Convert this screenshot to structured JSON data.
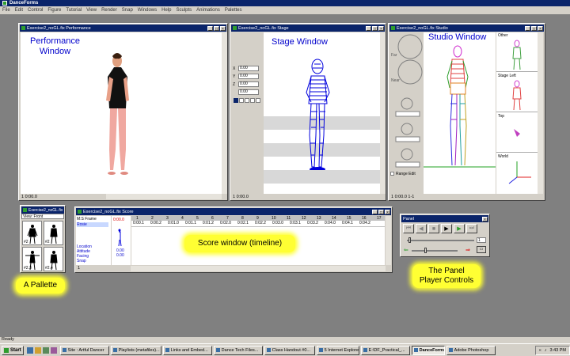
{
  "app": {
    "title": "DanceForms"
  },
  "menu": [
    "File",
    "Edit",
    "Control",
    "Figure",
    "Tutorial",
    "View",
    "Render",
    "Snap",
    "Windows",
    "Help",
    "Sculpts",
    "Animations",
    "Palettes"
  ],
  "windows": {
    "performance": {
      "title": "Exercise2_noGL.fix Performance",
      "caption": "Performance\nWindow",
      "status": "1 0:00.0"
    },
    "stage": {
      "title": "Exercise2_noGL.fix Stage",
      "caption": "Stage Window",
      "status": "1 0:00.0",
      "fields": [
        "0.00",
        "0.00",
        "0.00",
        "0.00"
      ],
      "field_labels": [
        "X",
        "Y",
        "Z",
        ""
      ]
    },
    "studio": {
      "title": "Exercise2_noGL.fix Studio",
      "caption": "Studio Window",
      "status": "1 0:00.0 1-1",
      "dial_labels": [
        "Far",
        "Near"
      ],
      "range_edit": "Range Edit",
      "views": [
        "Other",
        "Stage Left",
        "Top",
        "World"
      ]
    },
    "palette": {
      "title": "Exercise2_noGL.fix",
      "view": "View: Front",
      "cells": [
        "#2",
        "#2",
        "#2.3",
        "#2.4"
      ]
    },
    "score": {
      "title": "Exercise2_noGL.fix Score",
      "rows": [
        "M:S Frame",
        "Rosie",
        "",
        "Location",
        "Attitude",
        "Facing",
        "Snap"
      ],
      "frame_value": "0:00.0",
      "values": [
        "0.00",
        "0.00"
      ],
      "ticks": [
        "1",
        "2",
        "3",
        "4",
        "5",
        "6",
        "7",
        "8",
        "9",
        "10",
        "11",
        "12",
        "13",
        "14",
        "15",
        "16",
        "17"
      ],
      "times": [
        "0:00.1",
        "0:00.2",
        "0:01.0",
        "0:01.1",
        "0:01.2",
        "0:02.0",
        "0:02.1",
        "0:02.2",
        "0:03.0",
        "0:03.1",
        "0:03.2",
        "0:04.0",
        "0:04.1",
        "0:04.2"
      ],
      "status": "1"
    },
    "panel": {
      "title": "Panel",
      "frame": "1"
    }
  },
  "annotations": {
    "score": "Score window (timeline)",
    "palette": "A Pallette",
    "panel": "The Panel\nPlayer Controls"
  },
  "status_bar": "Ready",
  "taskbar": {
    "start": "Start",
    "tasks": [
      "Site : Artful Dancer",
      "Playlists (metafiles)...",
      "Links and Embed...",
      "Dance Tech Files...",
      "Class Handout #0...",
      "5 Internet Explorer",
      "E:\\DF_Practical_...",
      "DanceForms",
      "Adobe Photoshop"
    ],
    "clock": "3:43 PM"
  },
  "colors": {
    "titlebar": "#0a246a",
    "figure_blue": "#0000dd",
    "skin": "#e8a088",
    "highlight": "#ffff33"
  }
}
